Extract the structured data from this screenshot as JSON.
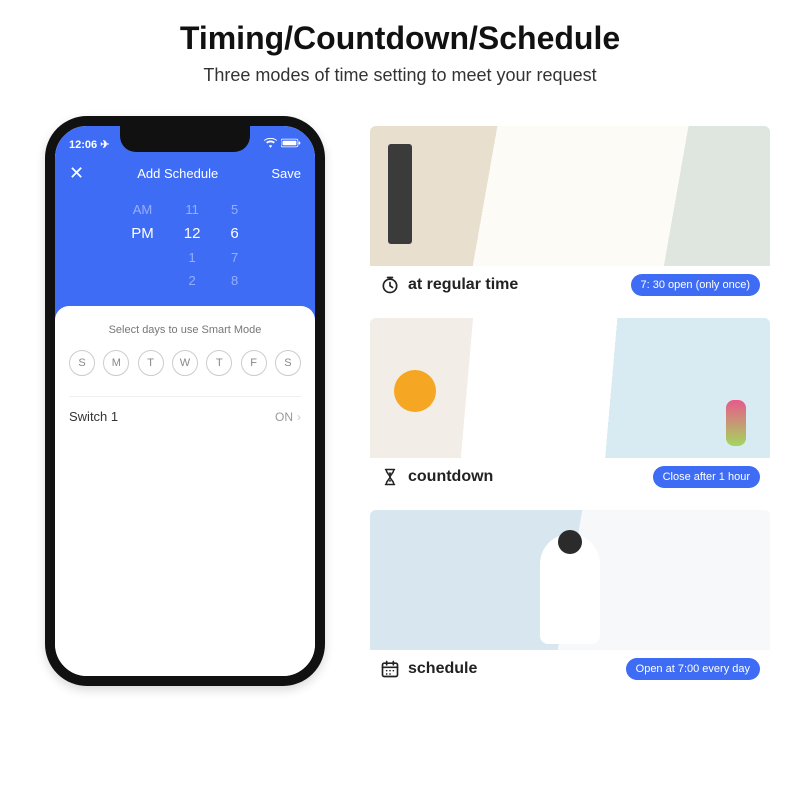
{
  "header": {
    "title": "Timing/Countdown/Schedule",
    "subtitle": "Three modes of time setting to meet your request"
  },
  "phone": {
    "status_time": "12:06",
    "nav_title": "Add Schedule",
    "nav_save": "Save",
    "picker": {
      "ampm_prev": "AM",
      "ampm_sel": "PM",
      "hour_prev": "11",
      "hour_sel": "12",
      "hour_next1": "1",
      "hour_next2": "2",
      "min_prev": "5",
      "min_sel": "6",
      "min_next1": "7",
      "min_next2": "8"
    },
    "sheet_title": "Select days to use Smart Mode",
    "days": [
      "S",
      "M",
      "T",
      "W",
      "T",
      "F",
      "S"
    ],
    "switch_label": "Switch 1",
    "switch_value": "ON"
  },
  "cards": [
    {
      "label": "at regular time",
      "badge": "7: 30 open (only once)",
      "icon": "clock"
    },
    {
      "label": "countdown",
      "badge": "Close after 1 hour",
      "icon": "hourglass"
    },
    {
      "label": "schedule",
      "badge": "Open at 7:00 every day",
      "icon": "calendar"
    }
  ]
}
